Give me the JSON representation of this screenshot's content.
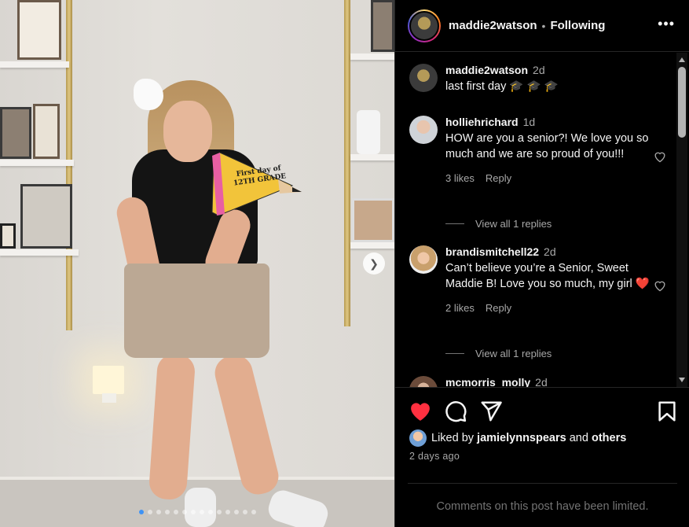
{
  "post": {
    "photo": {
      "pennant_text": "First day of 12TH GRADE",
      "carousel_dot_count": 14,
      "active_dot_index": 0
    }
  },
  "header": {
    "username": "maddie2watson",
    "separator": "•",
    "follow_status": "Following",
    "more_icon": "more-horizontal-icon"
  },
  "comments": [
    {
      "username": "maddie2watson",
      "time": "2d",
      "text": "last first day 🎓 🎓 🎓",
      "is_caption": true
    },
    {
      "username": "holliehrichard",
      "time": "1d",
      "text": "HOW are you a senior?! We love you so much and we are so proud of you!!!",
      "likes": "3 likes",
      "reply_label": "Reply",
      "view_replies": "View all 1 replies"
    },
    {
      "username": "brandismitchell22",
      "time": "2d",
      "text": "Can’t believe you’re a Senior, Sweet Maddie B! Love you so much, my girl ❤️",
      "likes": "2 likes",
      "reply_label": "Reply",
      "view_replies": "View all 1 replies"
    },
    {
      "username": "mcmorris_molly",
      "time": "2d"
    }
  ],
  "actions": {
    "liked": true,
    "like_color": "#ff3040",
    "liked_by_prefix": "Liked by",
    "liked_by_user": "jamielynnspears",
    "liked_by_and": "and",
    "liked_by_others": "others",
    "post_time": "2 days ago",
    "comments_limited": "Comments on this post have been limited."
  }
}
